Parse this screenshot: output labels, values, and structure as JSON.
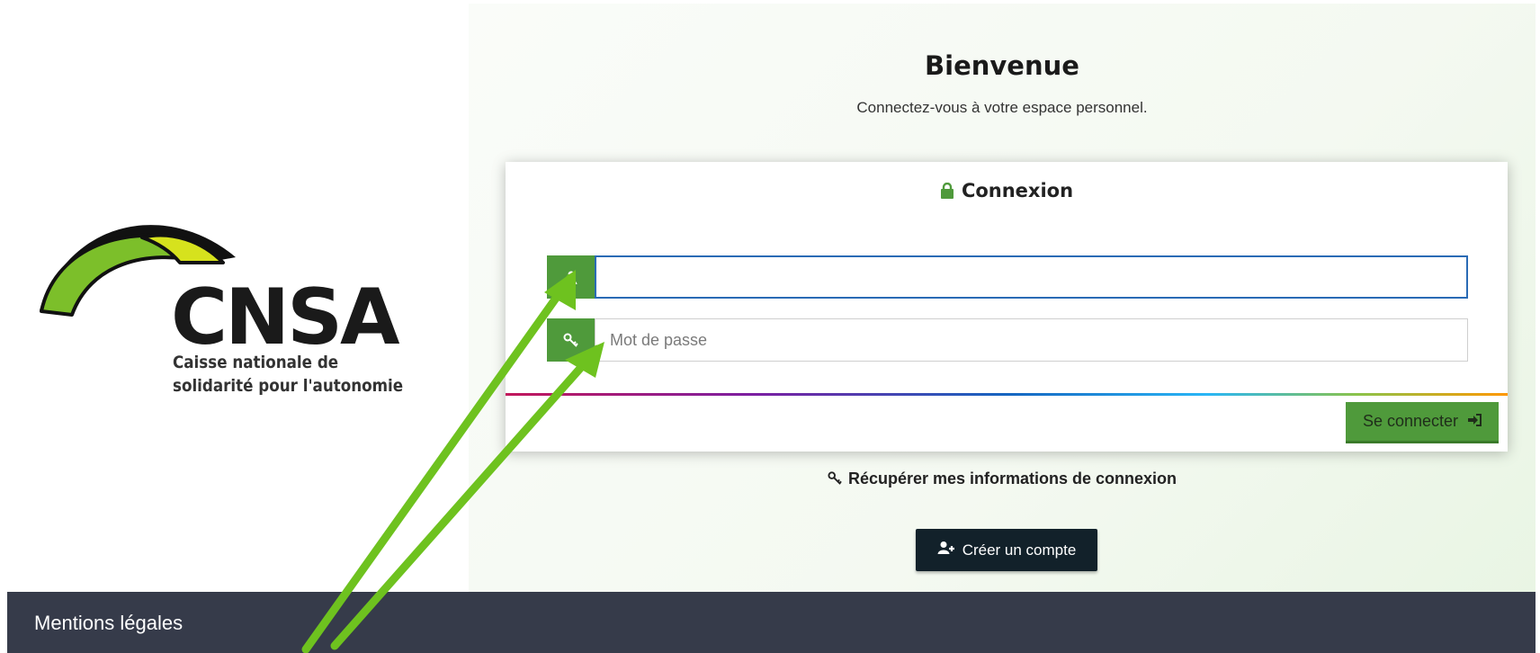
{
  "logo": {
    "name": "CNSA",
    "subtitle_line1": "Caisse nationale de",
    "subtitle_line2": "solidarité pour l'autonomie"
  },
  "welcome": {
    "title": "Bienvenue",
    "subtitle": "Connectez-vous à votre espace personnel."
  },
  "login_card": {
    "title": "Connexion",
    "username": {
      "value": "",
      "placeholder": ""
    },
    "password": {
      "value": "",
      "placeholder": "Mot de passe"
    },
    "submit_label": "Se connecter"
  },
  "recover_label": "Récupérer mes informations de connexion",
  "create_account_label": "Créer un compte",
  "footer": {
    "legal_label": "Mentions légales"
  },
  "colors": {
    "accent_green": "#4f9a3b",
    "footer_bg": "#363b4a",
    "dark_button": "#12212a",
    "annotation_arrow": "#6ec21f"
  },
  "icons": [
    "arch-logo",
    "lock-icon",
    "user-icon",
    "key-icon",
    "sign-in-icon",
    "user-plus-icon"
  ]
}
